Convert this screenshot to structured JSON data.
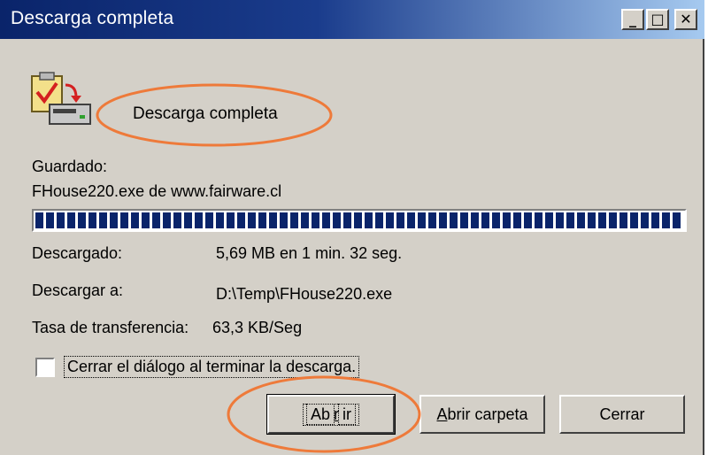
{
  "window": {
    "title": "Descarga completa",
    "controls": {
      "minimize": "_",
      "maximize": "□",
      "close": "✕"
    }
  },
  "header": {
    "status_text": "Descarga completa",
    "icon": "download-complete-icon"
  },
  "saved": {
    "label": "Guardado:",
    "file": "FHouse220.exe de www.fairware.cl"
  },
  "progress": {
    "fraction": 1.0
  },
  "details": {
    "downloaded_label": "Descargado:",
    "downloaded_value": "5,69 MB en 1 min. 32 seg.",
    "target_label": "Descargar a:",
    "target_value": "D:\\Temp\\FHouse220.exe",
    "rate_label": "Tasa de transferencia:",
    "rate_value": "63,3 KB/Seg"
  },
  "options": {
    "close_on_finish_label": "Cerrar el diálogo al terminar la descarga.",
    "close_on_finish_checked": false
  },
  "buttons": {
    "open_prefix": "Ab",
    "open_mnemonic": "r",
    "open_suffix": "ir",
    "folder_mnemonic": "A",
    "folder_rest": "brir carpeta",
    "close": "Cerrar"
  },
  "colors": {
    "titlebar_start": "#0a246a",
    "titlebar_end": "#a6caf0",
    "dialog_face": "#d4d0c8",
    "progress_fill": "#0a246a",
    "annotation": "#ee7a3a"
  }
}
